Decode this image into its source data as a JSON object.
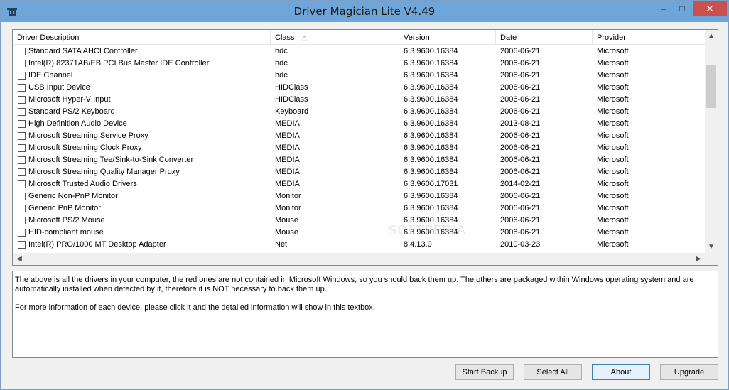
{
  "window": {
    "title": "Driver Magician Lite V4.49",
    "minimize_glyph": "–",
    "maximize_glyph": "□",
    "close_glyph": "✕"
  },
  "table": {
    "columns": [
      "Driver Description",
      "Class",
      "Version",
      "Date",
      "Provider"
    ],
    "sort_glyph": "△",
    "rows": [
      {
        "desc": "Standard SATA AHCI Controller",
        "class": "hdc",
        "version": "6.3.9600.16384",
        "date": "2006-06-21",
        "provider": "Microsoft"
      },
      {
        "desc": "Intel(R) 82371AB/EB PCI Bus Master IDE Controller",
        "class": "hdc",
        "version": "6.3.9600.16384",
        "date": "2006-06-21",
        "provider": "Microsoft"
      },
      {
        "desc": "IDE Channel",
        "class": "hdc",
        "version": "6.3.9600.16384",
        "date": "2006-06-21",
        "provider": "Microsoft"
      },
      {
        "desc": "USB Input Device",
        "class": "HIDClass",
        "version": "6.3.9600.16384",
        "date": "2006-06-21",
        "provider": "Microsoft"
      },
      {
        "desc": "Microsoft Hyper-V Input",
        "class": "HIDClass",
        "version": "6.3.9600.16384",
        "date": "2006-06-21",
        "provider": "Microsoft"
      },
      {
        "desc": "Standard PS/2 Keyboard",
        "class": "Keyboard",
        "version": "6.3.9600.16384",
        "date": "2006-06-21",
        "provider": "Microsoft"
      },
      {
        "desc": "High Definition Audio Device",
        "class": "MEDIA",
        "version": "6.3.9600.16384",
        "date": "2013-08-21",
        "provider": "Microsoft"
      },
      {
        "desc": "Microsoft Streaming Service Proxy",
        "class": "MEDIA",
        "version": "6.3.9600.16384",
        "date": "2006-06-21",
        "provider": "Microsoft"
      },
      {
        "desc": "Microsoft Streaming Clock Proxy",
        "class": "MEDIA",
        "version": "6.3.9600.16384",
        "date": "2006-06-21",
        "provider": "Microsoft"
      },
      {
        "desc": "Microsoft Streaming Tee/Sink-to-Sink Converter",
        "class": "MEDIA",
        "version": "6.3.9600.16384",
        "date": "2006-06-21",
        "provider": "Microsoft"
      },
      {
        "desc": "Microsoft Streaming Quality Manager Proxy",
        "class": "MEDIA",
        "version": "6.3.9600.16384",
        "date": "2006-06-21",
        "provider": "Microsoft"
      },
      {
        "desc": "Microsoft Trusted Audio Drivers",
        "class": "MEDIA",
        "version": "6.3.9600.17031",
        "date": "2014-02-21",
        "provider": "Microsoft"
      },
      {
        "desc": "Generic Non-PnP Monitor",
        "class": "Monitor",
        "version": "6.3.9600.16384",
        "date": "2006-06-21",
        "provider": "Microsoft"
      },
      {
        "desc": "Generic PnP Monitor",
        "class": "Monitor",
        "version": "6.3.9600.16384",
        "date": "2006-06-21",
        "provider": "Microsoft"
      },
      {
        "desc": "Microsoft PS/2 Mouse",
        "class": "Mouse",
        "version": "6.3.9600.16384",
        "date": "2006-06-21",
        "provider": "Microsoft"
      },
      {
        "desc": "HID-compliant mouse",
        "class": "Mouse",
        "version": "6.3.9600.16384",
        "date": "2006-06-21",
        "provider": "Microsoft"
      },
      {
        "desc": "Intel(R) PRO/1000 MT Desktop Adapter",
        "class": "Net",
        "version": "8.4.13.0",
        "date": "2010-03-23",
        "provider": "Microsoft"
      }
    ]
  },
  "info_text": "The above is all the drivers in your computer, the red ones are not contained in Microsoft Windows, so you should back them up. The others are packaged within Windows operating system and are\nautomatically installed when detected by it, therefore it is NOT necessary to back them up.\n\nFor more information of each device, please click it and the detailed information will show in this textbox.",
  "buttons": {
    "start_backup": "Start Backup",
    "select_all": "Select All",
    "about": "About",
    "upgrade": "Upgrade"
  },
  "watermark": "SOFTPEDIA",
  "colors": {
    "titlebar": "#6fa6da",
    "close_button": "#c75050"
  }
}
